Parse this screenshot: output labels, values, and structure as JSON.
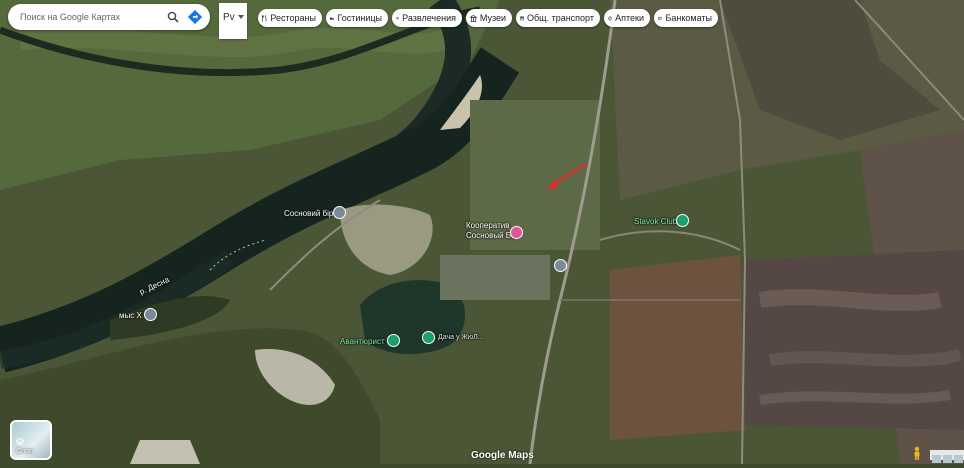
{
  "search": {
    "placeholder": "Поиск на Google Картах"
  },
  "language": {
    "label": "Рv"
  },
  "chips": [
    {
      "label": "Рестораны",
      "icon": "fork-knife-icon"
    },
    {
      "label": "Гостиницы",
      "icon": "bed-icon"
    },
    {
      "label": "Развлечения",
      "icon": "camera-icon"
    },
    {
      "label": "Музеи",
      "icon": "museum-icon"
    },
    {
      "label": "Общ. транспорт",
      "icon": "bus-icon"
    },
    {
      "label": "Аптеки",
      "icon": "pharmacy-icon"
    },
    {
      "label": "Банкоматы",
      "icon": "atm-icon"
    }
  ],
  "places": {
    "sosnovy_bir": "Сосновий бір",
    "mys_x": "мыс Х",
    "river": "р. Десна",
    "kooperativ": "Кооператив",
    "sosnovy_bor": "Сосновый Бор",
    "avantyurist": "Авантюрист",
    "stavok_club": "Stavok Club",
    "dacha": "Дача у ЖюЛ..."
  },
  "layers": {
    "label": "Слои"
  },
  "footer": {
    "brand": "Google Maps"
  },
  "colors": {
    "chip_bg": "#ffffff",
    "pin_gray": "#7a8a99",
    "pin_green": "#1e9e6a",
    "pin_pink": "#e0559a"
  }
}
